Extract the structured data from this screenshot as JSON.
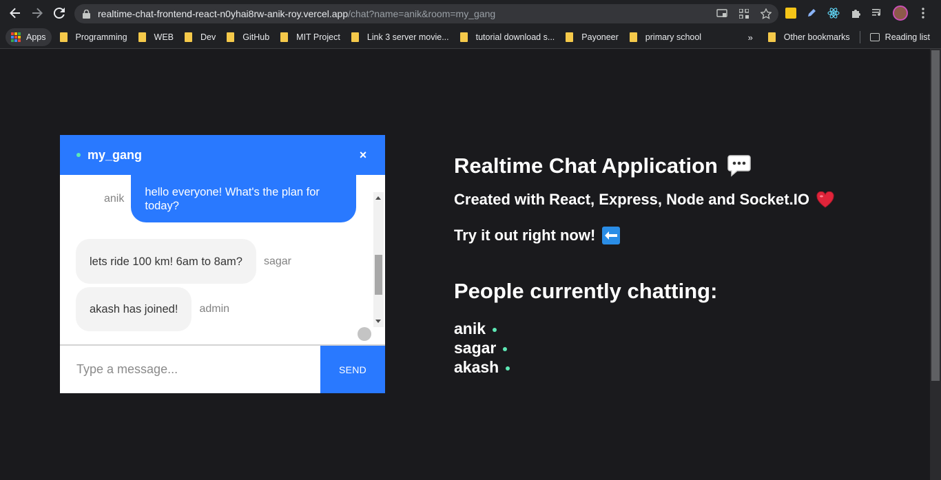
{
  "browser": {
    "url_host": "realtime-chat-frontend-react-n0yhai8rw-anik-roy.vercel.app",
    "url_path": "/chat?name=anik&room=my_gang",
    "bookmarks": [
      {
        "label": "Programming"
      },
      {
        "label": "WEB"
      },
      {
        "label": "Dev"
      },
      {
        "label": "GitHub"
      },
      {
        "label": "MIT Project"
      },
      {
        "label": "Link 3 server movie..."
      },
      {
        "label": "tutorial download s..."
      },
      {
        "label": "Payoneer"
      },
      {
        "label": "primary school"
      }
    ],
    "apps_label": "Apps",
    "other_bookmarks": "Other bookmarks",
    "reading_list": "Reading list",
    "more_chevron": "»"
  },
  "chat": {
    "room": "my_gang",
    "close_symbol": "×",
    "messages": [
      {
        "sender": "anik",
        "text_line1": "hello everyone! What's the plan for",
        "text_line2": "today?"
      },
      {
        "sender": "sagar",
        "text": "lets ride 100 km! 6am to 8am?"
      },
      {
        "sender": "admin",
        "text": "akash has joined!"
      }
    ],
    "input_placeholder": "Type a message...",
    "send_label": "SEND"
  },
  "info": {
    "title": "Realtime Chat Application",
    "subtitle": "Created with React, Express, Node and Socket.IO",
    "cta": "Try it out right now!",
    "people_title": "People currently chatting:",
    "people": [
      "anik",
      "sagar",
      "akash"
    ]
  },
  "colors": {
    "accent": "#2979ff",
    "online": "#5ee8b5",
    "page_bg": "#1a1a1d"
  }
}
